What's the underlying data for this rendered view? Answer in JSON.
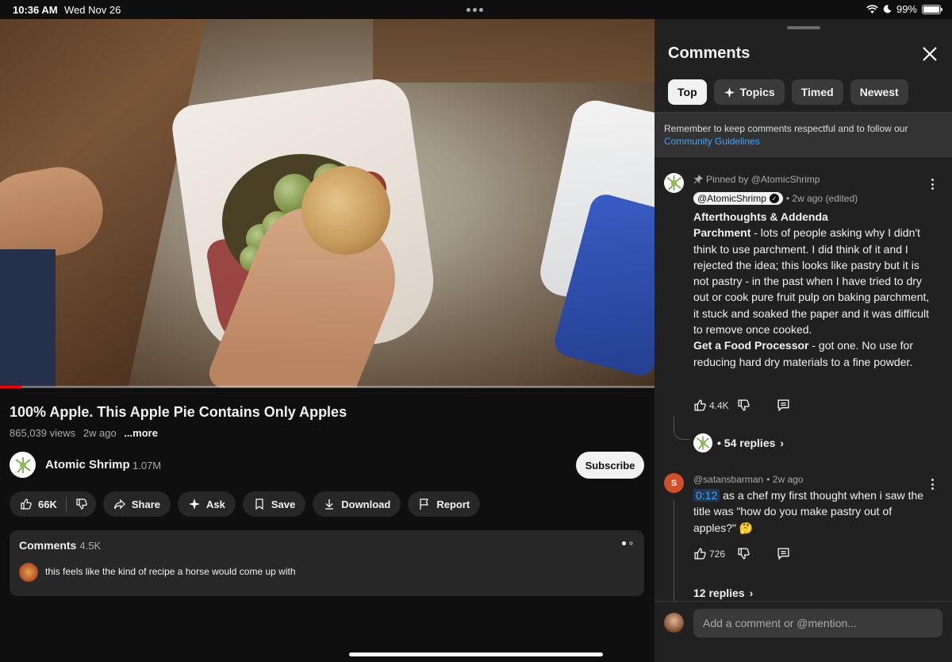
{
  "status_bar": {
    "time": "10:36 AM",
    "date": "Wed Nov 26",
    "battery": "99%",
    "battery_level": 0.99
  },
  "video": {
    "progress": 0.034,
    "title": "100% Apple. This Apple Pie Contains Only Apples",
    "views": "865,039 views",
    "age": "2w ago",
    "more": "...more"
  },
  "channel": {
    "name": "Atomic Shrimp",
    "subscribers": "1.07M",
    "subscribe_label": "Subscribe"
  },
  "actions": {
    "likes": "66K",
    "share": "Share",
    "ask": "Ask",
    "save": "Save",
    "download": "Download",
    "report": "Report"
  },
  "comments_card": {
    "title": "Comments",
    "count": "4.5K",
    "preview_text": "this feels like the kind of recipe a horse would come up with"
  },
  "panel": {
    "title": "Comments",
    "tabs": [
      {
        "label": "Top",
        "active": true
      },
      {
        "label": "Topics",
        "icon": "sparkle-icon"
      },
      {
        "label": "Timed"
      },
      {
        "label": "Newest"
      }
    ],
    "notice_text": "Remember to keep comments respectful and to follow our",
    "notice_link": "Community Guidelines",
    "comments": [
      {
        "pinned": "Pinned by @AtomicShrimp",
        "author": "@AtomicShrimp",
        "meta": "• 2w ago (edited)",
        "heading": "Afterthoughts & Addenda",
        "p1_bold": "Parchment",
        "p1_text": " - lots of people asking why I didn't think to use parchment.  I did think of it and I rejected the idea; this looks like pastry but it is not pastry - in the past when I have tried to dry out or cook pure fruit pulp on baking parchment, it stuck and soaked the paper and it was difficult to remove once cooked.",
        "p2_bold": "Get a Food Processor",
        "p2_text": " - got one. No use for reducing hard dry materials to a fine powder.",
        "likes": "4.4K",
        "replies": "• 54 replies"
      },
      {
        "avatar_letter": "S",
        "author": "@satansbarman",
        "meta": "• 2w ago",
        "timestamp": "0:12",
        "text": " as a chef my first thought when i saw the title was \"how do you make pastry out of apples?\" 🤔",
        "likes": "726",
        "replies": "12 replies"
      }
    ],
    "compose_placeholder": "Add a comment or @mention..."
  }
}
